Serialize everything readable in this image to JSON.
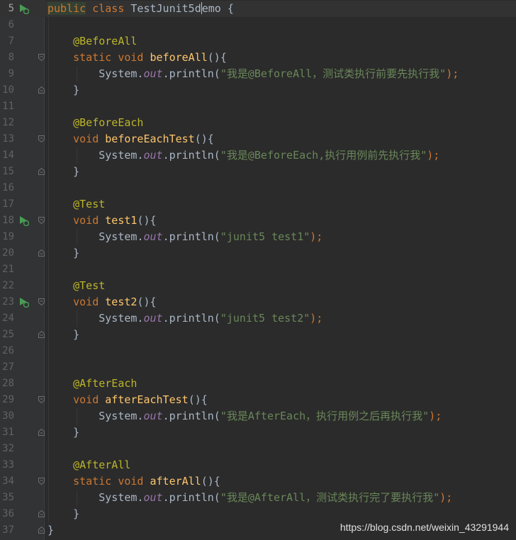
{
  "editor": {
    "lines": [
      {
        "num": "5",
        "tokens": [
          {
            "t": "public",
            "c": "kw hl"
          },
          {
            "t": " ",
            "c": "pl"
          },
          {
            "t": "class",
            "c": "kw"
          },
          {
            "t": " TestJunit5d",
            "c": "pl"
          },
          {
            "caret": true
          },
          {
            "t": "emo {",
            "c": "pl"
          }
        ],
        "run": true,
        "current": true
      },
      {
        "num": "6",
        "tokens": []
      },
      {
        "num": "7",
        "tokens": [
          {
            "t": "    @BeforeAll",
            "c": "ann"
          }
        ]
      },
      {
        "num": "8",
        "tokens": [
          {
            "t": "    static",
            "c": "kw"
          },
          {
            "t": " ",
            "c": "pl"
          },
          {
            "t": "void",
            "c": "kw"
          },
          {
            "t": " ",
            "c": "pl"
          },
          {
            "t": "beforeAll",
            "c": "fn"
          },
          {
            "t": "(){",
            "c": "pl"
          }
        ],
        "fold": "open"
      },
      {
        "num": "9",
        "tokens": [
          {
            "t": "        System.",
            "c": "pl"
          },
          {
            "t": "out",
            "c": "fld"
          },
          {
            "t": ".println(",
            "c": "pl"
          },
          {
            "t": "\"我是@BeforeAll，测试类执行前要先执行我\"",
            "c": "str"
          },
          {
            "t": ");",
            "c": "kw"
          }
        ]
      },
      {
        "num": "10",
        "tokens": [
          {
            "t": "    }",
            "c": "pl"
          }
        ],
        "fold": "close"
      },
      {
        "num": "11",
        "tokens": []
      },
      {
        "num": "12",
        "tokens": [
          {
            "t": "    @BeforeEach",
            "c": "ann"
          }
        ]
      },
      {
        "num": "13",
        "tokens": [
          {
            "t": "    void",
            "c": "kw"
          },
          {
            "t": " ",
            "c": "pl"
          },
          {
            "t": "beforeEachTest",
            "c": "fn"
          },
          {
            "t": "(){",
            "c": "pl"
          }
        ],
        "fold": "open"
      },
      {
        "num": "14",
        "tokens": [
          {
            "t": "        System.",
            "c": "pl"
          },
          {
            "t": "out",
            "c": "fld"
          },
          {
            "t": ".println(",
            "c": "pl"
          },
          {
            "t": "\"我是@BeforeEach,执行用例前先执行我\"",
            "c": "str"
          },
          {
            "t": ");",
            "c": "kw"
          }
        ]
      },
      {
        "num": "15",
        "tokens": [
          {
            "t": "    }",
            "c": "pl"
          }
        ],
        "fold": "close"
      },
      {
        "num": "16",
        "tokens": []
      },
      {
        "num": "17",
        "tokens": [
          {
            "t": "    @Test",
            "c": "ann"
          }
        ]
      },
      {
        "num": "18",
        "tokens": [
          {
            "t": "    void",
            "c": "kw"
          },
          {
            "t": " ",
            "c": "pl"
          },
          {
            "t": "test1",
            "c": "fn"
          },
          {
            "t": "(){",
            "c": "pl"
          }
        ],
        "fold": "open",
        "run": true
      },
      {
        "num": "19",
        "tokens": [
          {
            "t": "        System.",
            "c": "pl"
          },
          {
            "t": "out",
            "c": "fld"
          },
          {
            "t": ".println(",
            "c": "pl"
          },
          {
            "t": "\"junit5 test1\"",
            "c": "str"
          },
          {
            "t": ");",
            "c": "kw"
          }
        ]
      },
      {
        "num": "20",
        "tokens": [
          {
            "t": "    }",
            "c": "pl"
          }
        ],
        "fold": "close"
      },
      {
        "num": "21",
        "tokens": []
      },
      {
        "num": "22",
        "tokens": [
          {
            "t": "    @Test",
            "c": "ann"
          }
        ]
      },
      {
        "num": "23",
        "tokens": [
          {
            "t": "    void",
            "c": "kw"
          },
          {
            "t": " ",
            "c": "pl"
          },
          {
            "t": "test2",
            "c": "fn"
          },
          {
            "t": "(){",
            "c": "pl"
          }
        ],
        "fold": "open",
        "run": true
      },
      {
        "num": "24",
        "tokens": [
          {
            "t": "        System.",
            "c": "pl"
          },
          {
            "t": "out",
            "c": "fld"
          },
          {
            "t": ".println(",
            "c": "pl"
          },
          {
            "t": "\"junit5 test2\"",
            "c": "str"
          },
          {
            "t": ");",
            "c": "kw"
          }
        ]
      },
      {
        "num": "25",
        "tokens": [
          {
            "t": "    }",
            "c": "pl"
          }
        ],
        "fold": "close"
      },
      {
        "num": "26",
        "tokens": []
      },
      {
        "num": "27",
        "tokens": []
      },
      {
        "num": "28",
        "tokens": [
          {
            "t": "    @AfterEach",
            "c": "ann"
          }
        ]
      },
      {
        "num": "29",
        "tokens": [
          {
            "t": "    void",
            "c": "kw"
          },
          {
            "t": " ",
            "c": "pl"
          },
          {
            "t": "afterEachTest",
            "c": "fn"
          },
          {
            "t": "(){",
            "c": "pl"
          }
        ],
        "fold": "open"
      },
      {
        "num": "30",
        "tokens": [
          {
            "t": "        System.",
            "c": "pl"
          },
          {
            "t": "out",
            "c": "fld"
          },
          {
            "t": ".println(",
            "c": "pl"
          },
          {
            "t": "\"我是AfterEach，执行用例之后再执行我\"",
            "c": "str"
          },
          {
            "t": ");",
            "c": "kw"
          }
        ]
      },
      {
        "num": "31",
        "tokens": [
          {
            "t": "    }",
            "c": "pl"
          }
        ],
        "fold": "close"
      },
      {
        "num": "32",
        "tokens": []
      },
      {
        "num": "33",
        "tokens": [
          {
            "t": "    @AfterAll",
            "c": "ann"
          }
        ]
      },
      {
        "num": "34",
        "tokens": [
          {
            "t": "    static",
            "c": "kw"
          },
          {
            "t": " ",
            "c": "pl"
          },
          {
            "t": "void",
            "c": "kw"
          },
          {
            "t": " ",
            "c": "pl"
          },
          {
            "t": "afterAll",
            "c": "fn"
          },
          {
            "t": "(){",
            "c": "pl"
          }
        ],
        "fold": "open"
      },
      {
        "num": "35",
        "tokens": [
          {
            "t": "        System.",
            "c": "pl"
          },
          {
            "t": "out",
            "c": "fld"
          },
          {
            "t": ".println(",
            "c": "pl"
          },
          {
            "t": "\"我是@AfterAll，测试类执行完了要执行我\"",
            "c": "str"
          },
          {
            "t": ");",
            "c": "kw"
          }
        ]
      },
      {
        "num": "36",
        "tokens": [
          {
            "t": "    }",
            "c": "pl"
          }
        ],
        "fold": "close"
      },
      {
        "num": "37",
        "tokens": [
          {
            "t": "}",
            "c": "pl"
          }
        ],
        "fold": "close"
      }
    ]
  },
  "watermark": "https://blog.csdn.net/weixin_43291944",
  "colors": {
    "background": "#2b2b2b",
    "gutter": "#313335",
    "keyword": "#cc7832",
    "annotation": "#bbb529",
    "method": "#ffc66d",
    "string": "#6a8759",
    "field": "#9876aa",
    "text": "#a9b7c6",
    "line_number": "#606366",
    "run_icon": "#499c54"
  },
  "icons": {
    "run": "run-test-icon",
    "fold_open": "fold-open-icon",
    "fold_close": "fold-close-icon"
  }
}
